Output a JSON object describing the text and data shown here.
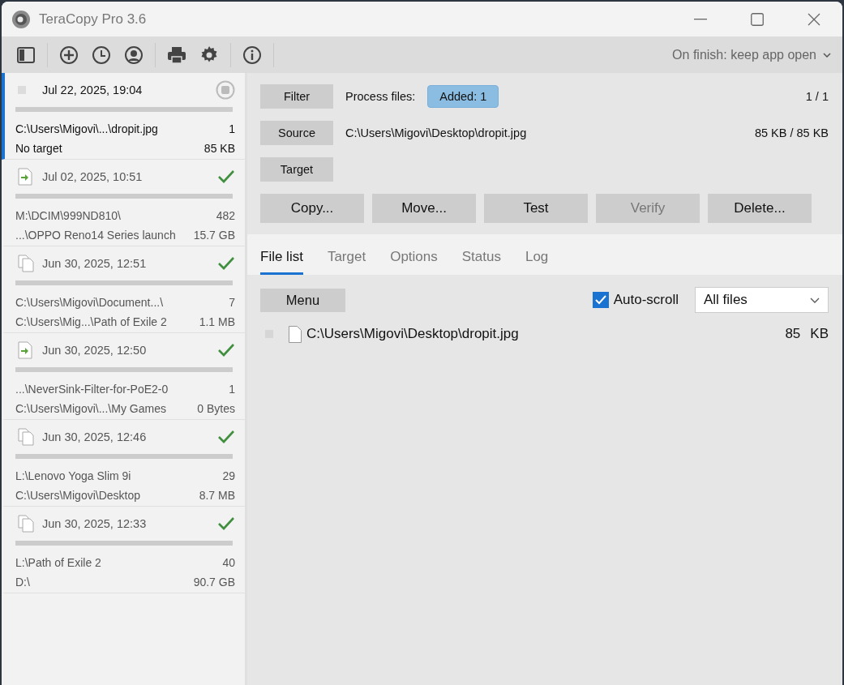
{
  "window": {
    "title": "TeraCopy Pro 3.6"
  },
  "toolbar": {
    "on_finish": "On finish: keep app open"
  },
  "history": [
    {
      "kind": "pending",
      "date": "Jul 22, 2025, 19:04",
      "source": "C:\\Users\\Migovi\\...\\dropit.jpg",
      "count": "1",
      "target": "No target",
      "size": "85 KB",
      "selected": true,
      "completed": false
    },
    {
      "kind": "move",
      "date": "Jul 02, 2025, 10:51",
      "source": "M:\\DCIM\\999ND810\\",
      "count": "482",
      "target": "...\\OPPO Reno14 Series launch",
      "size": "15.7 GB",
      "selected": false,
      "completed": true
    },
    {
      "kind": "copy",
      "date": "Jun 30, 2025, 12:51",
      "source": "C:\\Users\\Migovi\\Document...\\",
      "count": "7",
      "target": "C:\\Users\\Mig...\\Path of Exile 2",
      "size": "1.1 MB",
      "selected": false,
      "completed": true
    },
    {
      "kind": "move",
      "date": "Jun 30, 2025, 12:50",
      "source": "...\\NeverSink-Filter-for-PoE2-0",
      "count": "1",
      "target": "C:\\Users\\Migovi\\...\\My Games",
      "size": "0 Bytes",
      "selected": false,
      "completed": true
    },
    {
      "kind": "copy",
      "date": "Jun 30, 2025, 12:46",
      "source": "L:\\Lenovo Yoga Slim 9i",
      "count": "29",
      "target": "C:\\Users\\Migovi\\Desktop",
      "size": "8.7 MB",
      "selected": false,
      "completed": true
    },
    {
      "kind": "copy",
      "date": "Jun 30, 2025, 12:33",
      "source": "L:\\Path of Exile 2",
      "count": "40",
      "target": "D:\\",
      "size": "90.7 GB",
      "selected": false,
      "completed": true
    }
  ],
  "panel": {
    "filter_button": "Filter",
    "process_label": "Process files:",
    "added_chip": "Added: 1",
    "counter": "1 / 1",
    "source_button": "Source",
    "source_path": "C:\\Users\\Migovi\\Desktop\\dropit.jpg",
    "source_size": "85 KB / 85 KB",
    "target_button": "Target",
    "actions": [
      {
        "label": "Copy...",
        "disabled": false
      },
      {
        "label": "Move...",
        "disabled": false
      },
      {
        "label": "Test",
        "disabled": false
      },
      {
        "label": "Verify",
        "disabled": true
      },
      {
        "label": "Delete...",
        "disabled": false
      }
    ]
  },
  "tabs": [
    {
      "label": "File list",
      "selected": true
    },
    {
      "label": "Target",
      "selected": false
    },
    {
      "label": "Options",
      "selected": false
    },
    {
      "label": "Status",
      "selected": false
    },
    {
      "label": "Log",
      "selected": false
    }
  ],
  "file_list": {
    "menu_button": "Menu",
    "auto_scroll": {
      "label": "Auto-scroll",
      "checked": true
    },
    "filter_select": "All files",
    "files": [
      {
        "name": "C:\\Users\\Migovi\\Desktop\\dropit.jpg",
        "size": "85",
        "unit": "KB"
      }
    ]
  }
}
